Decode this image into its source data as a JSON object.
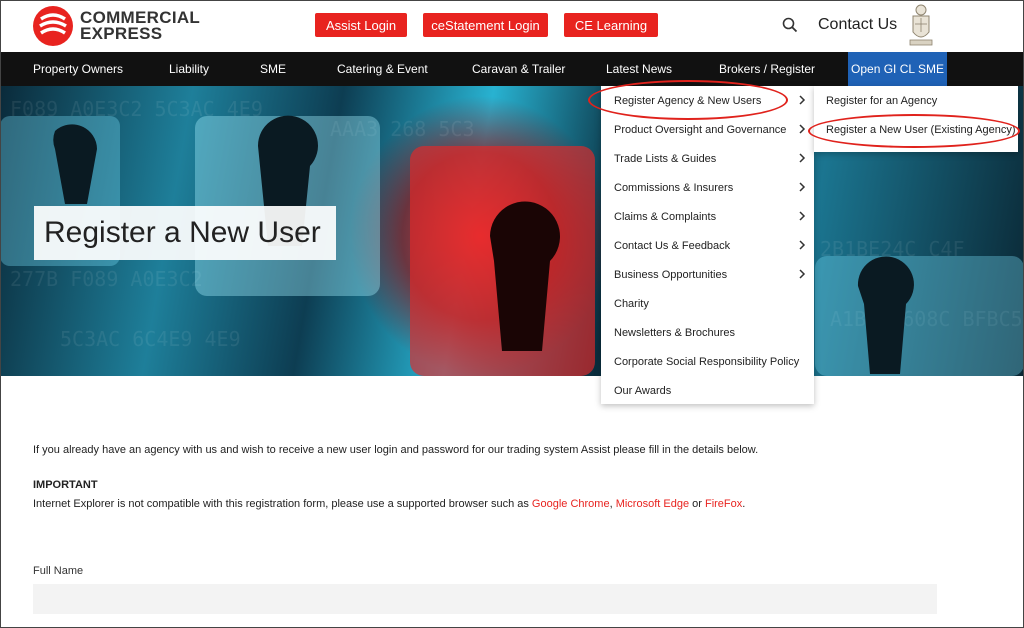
{
  "brand": {
    "line1": "COMMERCIAL",
    "line2": "EXPRESS",
    "color": "#e8231f"
  },
  "header": {
    "buttons": [
      "Assist Login",
      "ceStatement Login",
      "CE Learning"
    ],
    "contact": "Contact Us",
    "search_icon": "search-icon",
    "crest_icon": "crest-icon"
  },
  "nav": {
    "items": [
      "Property Owners",
      "Liability",
      "SME",
      "Catering & Event",
      "Caravan & Trailer",
      "Latest News",
      "Brokers / Register",
      "Open GI CL SME"
    ],
    "active_color": "#1f62b6"
  },
  "hero": {
    "title": "Register a New User"
  },
  "dropdown": {
    "items": [
      {
        "label": "Register Agency & New Users",
        "has_sub": true
      },
      {
        "label": "Product Oversight and Governance",
        "has_sub": true
      },
      {
        "label": "Trade Lists & Guides",
        "has_sub": true
      },
      {
        "label": "Commissions & Insurers",
        "has_sub": true
      },
      {
        "label": "Claims & Complaints",
        "has_sub": true
      },
      {
        "label": "Contact Us & Feedback",
        "has_sub": true
      },
      {
        "label": "Business Opportunities",
        "has_sub": true
      },
      {
        "label": "Charity",
        "has_sub": false
      },
      {
        "label": "Newsletters & Brochures",
        "has_sub": false
      },
      {
        "label": "Corporate Social Responsibility Policy",
        "has_sub": false
      },
      {
        "label": "Our Awards",
        "has_sub": false
      }
    ]
  },
  "submenu": {
    "items": [
      "Register for an Agency",
      "Register a New User (Existing Agency)"
    ]
  },
  "content": {
    "intro": "If you already have an agency with us and wish to receive a new user login and password for our trading system Assist please fill in the details below.",
    "important_heading": "IMPORTANT",
    "ie_prefix": "Internet Explorer is not compatible with this registration form, please use a supported browser such as ",
    "browser1": "Google Chrome",
    "sep1": ", ",
    "browser2": "Microsoft Edge",
    "sep2": " or ",
    "browser3": "FireFox",
    "suffix": ".",
    "full_name_label": "Full Name",
    "full_name_value": ""
  }
}
